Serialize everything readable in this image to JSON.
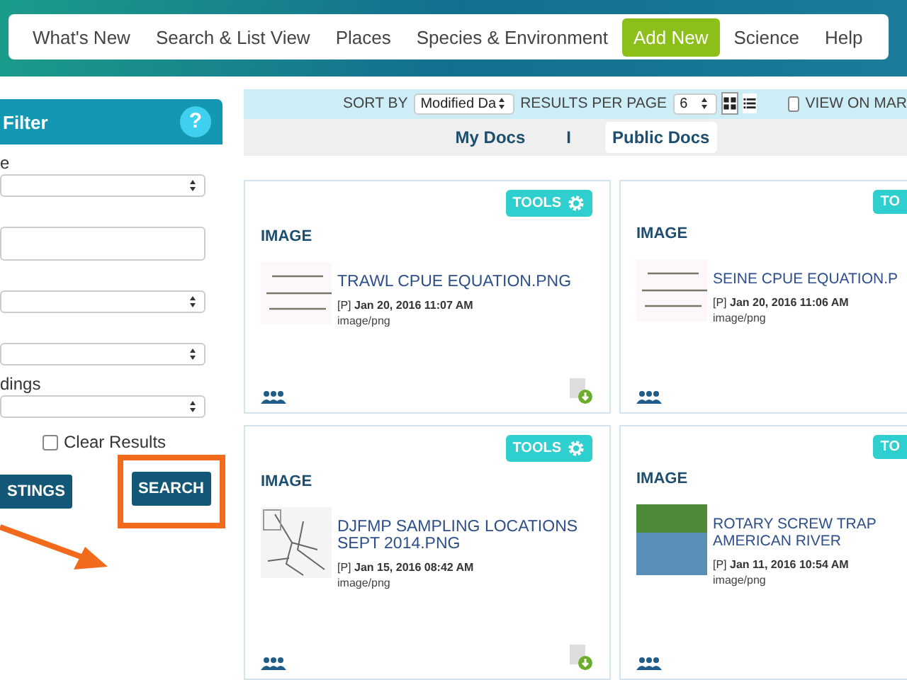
{
  "nav": [
    {
      "label": "What's New",
      "selected": false
    },
    {
      "label": "Search & List View",
      "selected": false
    },
    {
      "label": "Places",
      "selected": false
    },
    {
      "label": "Species & Environment",
      "selected": false
    },
    {
      "label": "Add New",
      "selected": true
    },
    {
      "label": "Science",
      "selected": false
    },
    {
      "label": "Help",
      "selected": false
    }
  ],
  "sidebar": {
    "title": "Filter",
    "help": "?",
    "fields": [
      {
        "kind": "select",
        "label": "e"
      },
      {
        "kind": "text"
      },
      {
        "kind": "select"
      },
      {
        "kind": "select"
      },
      {
        "kind": "select",
        "label": "dings"
      }
    ],
    "clear_results": {
      "label": "Clear Results",
      "checked": false
    },
    "buttons": [
      {
        "label": "STINGS",
        "highlighted": false
      },
      {
        "label": "SEARCH",
        "highlighted": true
      }
    ]
  },
  "toolbar": {
    "sort_label": "SORT BY",
    "sort_value": "Modified Da",
    "per_page_label": "RESULTS PER PAGE",
    "per_page_value": "6",
    "views": [
      {
        "kind": "grid",
        "selected": true
      },
      {
        "kind": "list",
        "selected": false
      }
    ],
    "map": {
      "label": "VIEW ON MAR",
      "checked": false
    }
  },
  "doc_tabs": [
    {
      "label": "My Docs",
      "selected": false
    },
    {
      "label": "Public Docs",
      "selected": true
    }
  ],
  "doc_tab_separator": "I",
  "cards": [
    {
      "type_label": "IMAGE",
      "tools": "TOOLS",
      "thumbnail": {
        "kind": "equation"
      },
      "title": "TRAWL CPUE EQUATION.PNG",
      "prefix": "[P]",
      "date": "Jan 20, 2016 11:07 AM",
      "mime": "image/png",
      "download": true
    },
    {
      "type_label": "IMAGE",
      "tools": "TO",
      "thumbnail": {
        "kind": "equation"
      },
      "title": "SEINE CPUE EQUATION.P",
      "prefix": "[P]",
      "date": "Jan 20, 2016 11:06 AM",
      "mime": "image/png",
      "download": false
    },
    {
      "type_label": "IMAGE",
      "tools": "TOOLS",
      "thumbnail": {
        "kind": "map"
      },
      "title": "DJFMP SAMPLING LOCATIONS SEPT 2014.PNG",
      "prefix": "[P]",
      "date": "Jan 15, 2016 08:42 AM",
      "mime": "image/png",
      "download": true
    },
    {
      "type_label": "IMAGE",
      "tools": "TO",
      "thumbnail": {
        "kind": "photo"
      },
      "title": "ROTARY SCREW TRAP AMERICAN RIVER",
      "prefix": "[P]",
      "date": "Jan 11, 2016 10:54 AM",
      "mime": "image/png",
      "download": false
    }
  ]
}
